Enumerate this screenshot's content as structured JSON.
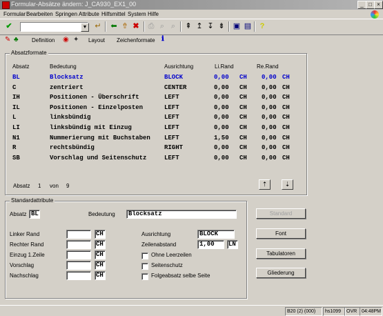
{
  "window": {
    "title": "Formular-Absätze ändern: J_CA930_EX1_00",
    "minimize": "_",
    "maximize": "□",
    "close": "×"
  },
  "menu": [
    "Formular",
    "Bearbeiten",
    "Springen",
    "Attribute",
    "Hilfsmittel",
    "System",
    "Hilfe"
  ],
  "toolbar2": {
    "definition": "Definition",
    "layout": "Layout",
    "zeichenformate": "Zeichenformate"
  },
  "absatzformate": {
    "group_label": "Absatzformate",
    "headers": {
      "absatz": "Absatz",
      "bedeutung": "Bedeutung",
      "ausrichtung": "Ausrichtung",
      "li_rand": "Li.Rand",
      "re_rand": "Re.Rand"
    },
    "rows": [
      {
        "absatz": "BL",
        "bedeutung": "Blocksatz",
        "ausrichtung": "BLOCK",
        "li": "0,00",
        "li_unit": "CH",
        "re": "0,00",
        "re_unit": "CH"
      },
      {
        "absatz": "C",
        "bedeutung": "zentriert",
        "ausrichtung": "CENTER",
        "li": "0,00",
        "li_unit": "CH",
        "re": "0,00",
        "re_unit": "CH"
      },
      {
        "absatz": "IH",
        "bedeutung": "Positionen - Überschrift",
        "ausrichtung": "LEFT",
        "li": "0,00",
        "li_unit": "CH",
        "re": "0,00",
        "re_unit": "CH"
      },
      {
        "absatz": "IL",
        "bedeutung": "Positionen - Einzelposten",
        "ausrichtung": "LEFT",
        "li": "0,00",
        "li_unit": "CH",
        "re": "0,00",
        "re_unit": "CH"
      },
      {
        "absatz": "L",
        "bedeutung": "linksbündig",
        "ausrichtung": "LEFT",
        "li": "0,00",
        "li_unit": "CH",
        "re": "0,00",
        "re_unit": "CH"
      },
      {
        "absatz": "LI",
        "bedeutung": "linksbündig mit Einzug",
        "ausrichtung": "LEFT",
        "li": "0,00",
        "li_unit": "CH",
        "re": "0,00",
        "re_unit": "CH"
      },
      {
        "absatz": "N1",
        "bedeutung": "Nummerierung mit Buchstaben",
        "ausrichtung": "LEFT",
        "li": "1,50",
        "li_unit": "CH",
        "re": "0,00",
        "re_unit": "CH"
      },
      {
        "absatz": "R",
        "bedeutung": "rechtsbündig",
        "ausrichtung": "RIGHT",
        "li": "0,00",
        "li_unit": "CH",
        "re": "0,00",
        "re_unit": "CH"
      },
      {
        "absatz": "SB",
        "bedeutung": "Vorschlag und Seitenschutz",
        "ausrichtung": "LEFT",
        "li": "0,00",
        "li_unit": "CH",
        "re": "0,00",
        "re_unit": "CH"
      }
    ],
    "footer_absatz": "Absatz",
    "footer_current": "1",
    "footer_von": "von",
    "footer_total": "9"
  },
  "standard": {
    "group_label": "Standardattribute",
    "absatz_label": "Absatz",
    "absatz_value": "BL",
    "bedeutung_label": "Bedeutung",
    "bedeutung_value": "Blocksatz",
    "linker_rand": "Linker Rand",
    "rechter_rand": "Rechter Rand",
    "einzug": "Einzug 1.Zeile",
    "vorschlag": "Vorschlag",
    "nachschlag": "Nachschlag",
    "unit": "CH",
    "ausrichtung_label": "Ausrichtung",
    "ausrichtung_value": "BLOCK",
    "zeilenabstand_label": "Zeilenabstand",
    "zeilenabstand_value": "1,00",
    "zeilenabstand_unit": "LN",
    "ohne_leerzeilen": "Ohne Leerzeilen",
    "seitenschutz": "Seitenschutz",
    "folgeabsatz": "Folgeabsatz selbe Seite"
  },
  "side_buttons": {
    "standard": "Standard",
    "font": "Font",
    "tabulatoren": "Tabulatoren",
    "gliederung": "Gliederung"
  },
  "statusbar": {
    "session": "B20 (2) (000)",
    "host": "hs1099",
    "mode": "OVR",
    "time": "04:48PM"
  },
  "colors": {
    "selected_row": "#0000cc",
    "title_gradient_start": "#808080"
  }
}
